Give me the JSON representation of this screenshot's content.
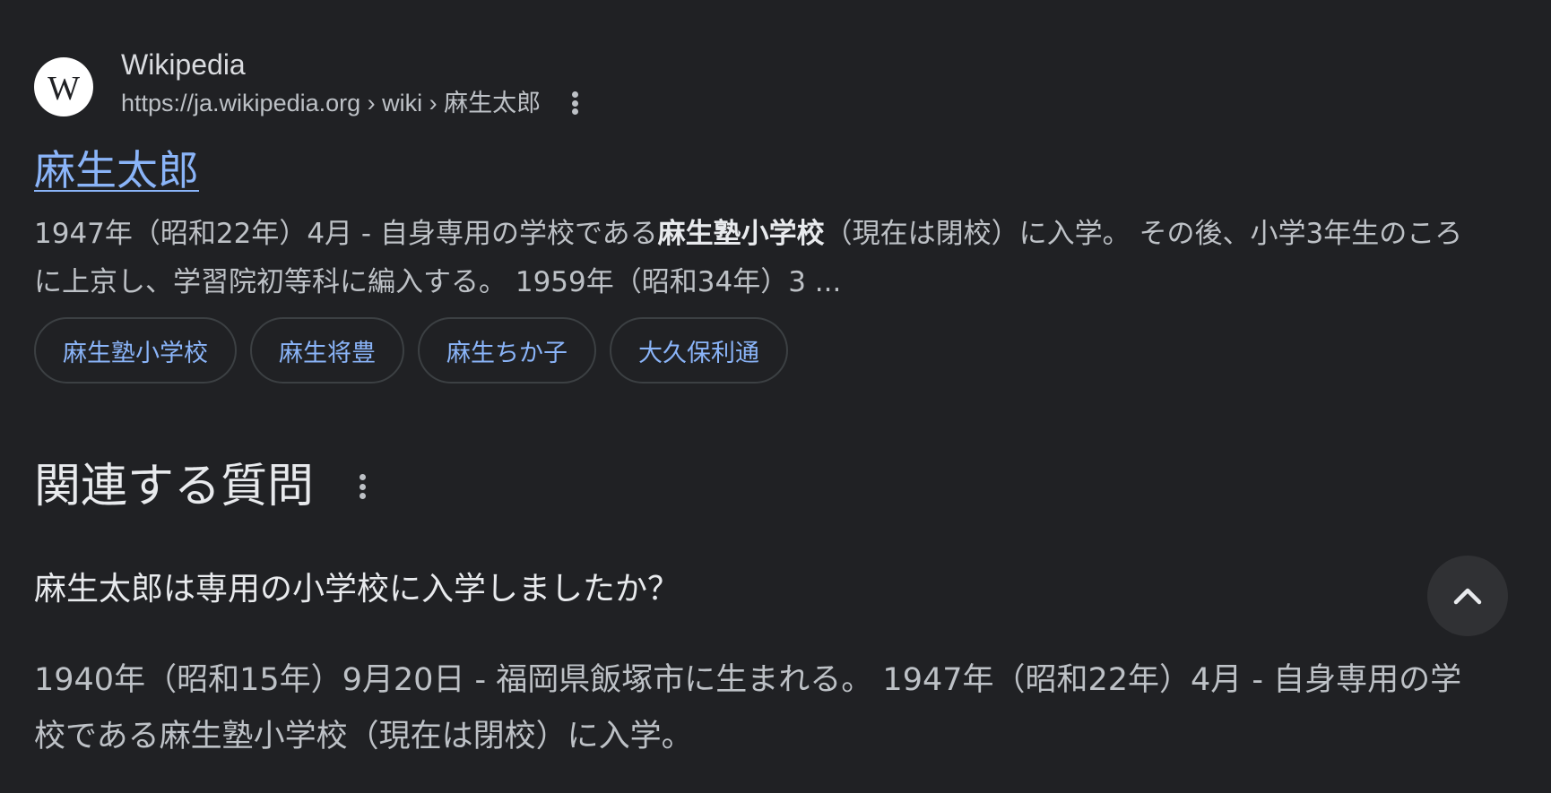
{
  "result": {
    "favicon_letter": "W",
    "site_name": "Wikipedia",
    "url": "https://ja.wikipedia.org › wiki › 麻生太郎",
    "title": "麻生太郎",
    "snippet": {
      "part1": "1947年（昭和22年）4月 - 自身専用の学校である",
      "bold": "麻生塾小学校",
      "part2": "（現在は閉校）に入学。 その後、小学3年生のころに上京し、学習院初等科に編入する。 1959年（昭和34年）3 ..."
    },
    "chips": [
      {
        "label": "麻生塾小学校"
      },
      {
        "label": "麻生将豊"
      },
      {
        "label": "麻生ちか子"
      },
      {
        "label": "大久保利通"
      }
    ]
  },
  "related_questions": {
    "heading": "関連する質問",
    "items": [
      {
        "question": "麻生太郎は専用の小学校に入学しましたか？",
        "expanded": true,
        "answer": "1940年（昭和15年）9月20日 - 福岡県飯塚市に生まれる。 1947年（昭和22年）4月 - 自身専用の学校である麻生塾小学校（現在は閉校）に入学。"
      }
    ]
  },
  "colors": {
    "background": "#202124",
    "link": "#8ab4f8",
    "text": "#bdc1c6",
    "heading": "#e8eaed",
    "chip_border": "#3c4043",
    "button_bg": "#303134"
  },
  "icons": {
    "favicon": "wikipedia-logo-icon",
    "more": "more-vert-icon",
    "expand": "chevron-up-icon"
  }
}
